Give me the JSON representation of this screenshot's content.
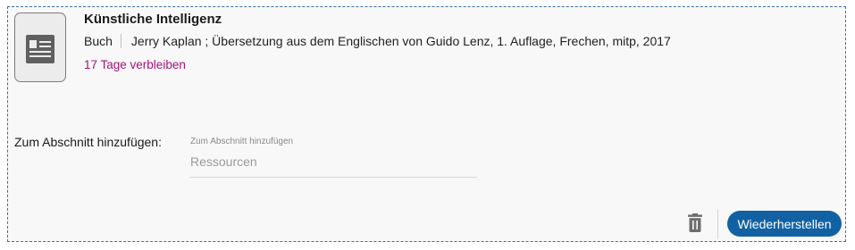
{
  "item": {
    "thumbnail_icon": "document-icon",
    "title": "Künstliche Intelligenz",
    "type": "Buch",
    "details": "Jerry Kaplan ; Übersetzung aus dem Englischen von Guido Lenz, 1. Auflage, Frechen, mitp, 2017",
    "due": "17 Tage verbleiben",
    "due_color": "#a3137a"
  },
  "section": {
    "label": "Zum Abschnitt hinzufügen:",
    "field_label": "Zum Abschnitt hinzufügen",
    "placeholder": "Ressourcen",
    "value": ""
  },
  "actions": {
    "delete_icon": "trash-icon",
    "restore_label": "Wiederherstellen",
    "restore_color": "#1262a3"
  }
}
